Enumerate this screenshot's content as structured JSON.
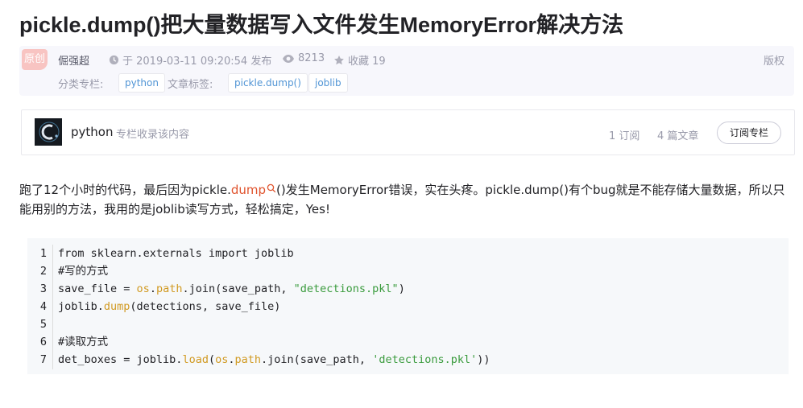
{
  "article": {
    "title": "pickle.dump()把大量数据写入文件发生MemoryError解决方法",
    "original_badge": "原创",
    "author": "倔强超",
    "date_text": "于 2019-03-11 09:20:54 发布",
    "views": "8213",
    "favorites_text": "收藏 19",
    "copyright": "版权",
    "category_label": "分类专栏:",
    "categories": [
      "python"
    ],
    "tags_label": "文章标签:",
    "tags": [
      "pickle.dump()",
      "joblib"
    ]
  },
  "column": {
    "name": "python",
    "desc": "专栏收录该内容",
    "subscribers": "1 订阅",
    "articles": "4 篇文章",
    "subscribe_button": "订阅专栏"
  },
  "body": {
    "p1_before": "跑了12个小时的代码，最后因为pickle.",
    "p1_link": "dump",
    "p1_after": "()发生MemoryError错误，实在头疼。pickle.dump()有个bug就是不能存储大量数据，所以只能用别的方法，我用的是joblib读写方式，轻松搞定，Yes!"
  },
  "code": {
    "line_numbers": [
      "1",
      "2",
      "3",
      "4",
      "5",
      "6",
      "7"
    ],
    "l1": "from sklearn.externals import joblib",
    "l2": "#写的方式",
    "l3a": "save_file = ",
    "l3b": "os",
    "l3c": ".",
    "l3d": "path",
    "l3e": ".join(save_path, ",
    "l3f": "\"detections.pkl\"",
    "l3g": ")",
    "l4a": "joblib.",
    "l4b": "dump",
    "l4c": "(detections, save_file)",
    "l6": "#读取方式",
    "l7a": "det_boxes = joblib.",
    "l7b": "load",
    "l7c": "(",
    "l7d": "os",
    "l7e": ".",
    "l7f": "path",
    "l7g": ".join(save_path, ",
    "l7h": "'detections.pkl'",
    "l7i": "))"
  }
}
